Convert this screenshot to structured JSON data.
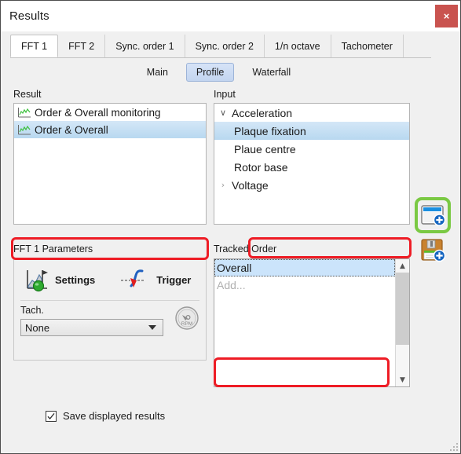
{
  "window": {
    "title": "Results",
    "close_label": "×"
  },
  "tabs": [
    {
      "label": "FFT 1",
      "active": true
    },
    {
      "label": "FFT 2",
      "active": false
    },
    {
      "label": "Sync. order 1",
      "active": false
    },
    {
      "label": "Sync. order 2",
      "active": false
    },
    {
      "label": "1/n octave",
      "active": false
    },
    {
      "label": "Tachometer",
      "active": false
    }
  ],
  "subtabs": [
    {
      "label": "Main",
      "active": false
    },
    {
      "label": "Profile",
      "active": true
    },
    {
      "label": "Waterfall",
      "active": false
    }
  ],
  "result": {
    "label": "Result",
    "items": [
      {
        "label": "Order & Overall monitoring",
        "selected": false
      },
      {
        "label": "Order & Overall",
        "selected": true
      }
    ]
  },
  "input": {
    "label": "Input",
    "nodes": [
      {
        "label": "Acceleration",
        "type": "group",
        "expanded": true,
        "chevron": "∨",
        "selected": false
      },
      {
        "label": "Plaque fixation",
        "type": "child",
        "selected": true
      },
      {
        "label": "Plaue centre",
        "type": "child",
        "selected": false
      },
      {
        "label": "Rotor base",
        "type": "child",
        "selected": false
      },
      {
        "label": "Voltage",
        "type": "group",
        "expanded": false,
        "chevron": "›",
        "selected": false
      }
    ]
  },
  "side_buttons": [
    {
      "name": "new-result-button",
      "icon": "window-add-icon",
      "highlighted": true
    },
    {
      "name": "save-result-button",
      "icon": "floppy-add-icon",
      "highlighted": false
    }
  ],
  "parameters": {
    "label": "FFT 1  Parameters",
    "settings_label": "Settings",
    "trigger_label": "Trigger",
    "tach_label": "Tach.",
    "tach_value": "None",
    "tach_options": [
      "None"
    ]
  },
  "tracked_order": {
    "label": "Tracked Order",
    "items": [
      {
        "label": "Overall",
        "selected": true,
        "placeholder": false
      },
      {
        "label": "Add...",
        "selected": false,
        "placeholder": true
      }
    ]
  },
  "footer": {
    "save_displayed_results_label": "Save displayed results",
    "save_displayed_results_checked": true
  },
  "colors": {
    "close_button": "#c9534f",
    "annotation": "#ee1c25",
    "highlight": "#7ac943",
    "selection": "#b8d8f0",
    "subtab_active": "#c3d5f0"
  }
}
